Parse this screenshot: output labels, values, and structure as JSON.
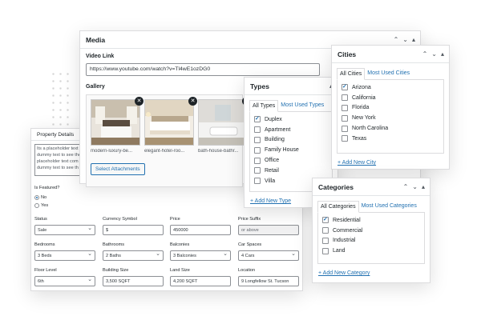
{
  "media": {
    "title": "Media",
    "video_label": "Video Link",
    "video_value": "https://www.youtube.com/watch?v=Tl4wE1ozDG0",
    "gallery_label": "Gallery",
    "thumbs": [
      {
        "caption": "modern-luxury-be..."
      },
      {
        "caption": "elegant-hotel-roo..."
      },
      {
        "caption": "bath-house-bathr..."
      }
    ],
    "select_button": "Select Attachments"
  },
  "property": {
    "title": "Property Details",
    "description": "Its a placeholder text - dummy text to see the placeholder text com dummy text to see th",
    "featured_label": "Is Featured?",
    "featured_options": [
      "No",
      "Yes"
    ],
    "fields": [
      {
        "label": "Status",
        "value": "Sale"
      },
      {
        "label": "Currency Symbol",
        "value": "$"
      },
      {
        "label": "Price",
        "value": "450000"
      },
      {
        "label": "Price Suffix",
        "value": "or above"
      },
      {
        "label": "Bedrooms",
        "value": "3 Beds"
      },
      {
        "label": "Bathrooms",
        "value": "2 Baths"
      },
      {
        "label": "Balconies",
        "value": "3 Balconies"
      },
      {
        "label": "Car Spaces",
        "value": "4 Cars"
      },
      {
        "label": "Floor Level",
        "value": "6th"
      },
      {
        "label": "Building Size",
        "value": "3,500 SQFT"
      },
      {
        "label": "Land Size",
        "value": "4,200 SQFT"
      },
      {
        "label": "Location",
        "value": "9 Longfellow St. Tucson"
      }
    ]
  },
  "types": {
    "title": "Types",
    "tab_all": "All Types",
    "tab_most": "Most Used Types",
    "items": [
      "Duplex",
      "Apartment",
      "Building",
      "Family House",
      "Office",
      "Retail",
      "Villa"
    ],
    "add_new": "+ Add New Type"
  },
  "cities": {
    "title": "Cities",
    "tab_all": "All Cities",
    "tab_most": "Most Used Cities",
    "items": [
      "Arizona",
      "California",
      "Florida",
      "New York",
      "North Carolina",
      "Texas"
    ],
    "add_new": "+ Add New City"
  },
  "categories": {
    "title": "Categories",
    "tab_all": "All Categories",
    "tab_most": "Most Used Categories",
    "items": [
      "Residential",
      "Commercial",
      "Industrial",
      "Land"
    ],
    "add_new": "+ Add New Category"
  },
  "controls": {
    "up": "⌃",
    "down": "⌄",
    "toggle": "▴"
  },
  "colors": {
    "accent": "#2271b1",
    "text": "#1d2327",
    "border": "#dcdcde"
  }
}
